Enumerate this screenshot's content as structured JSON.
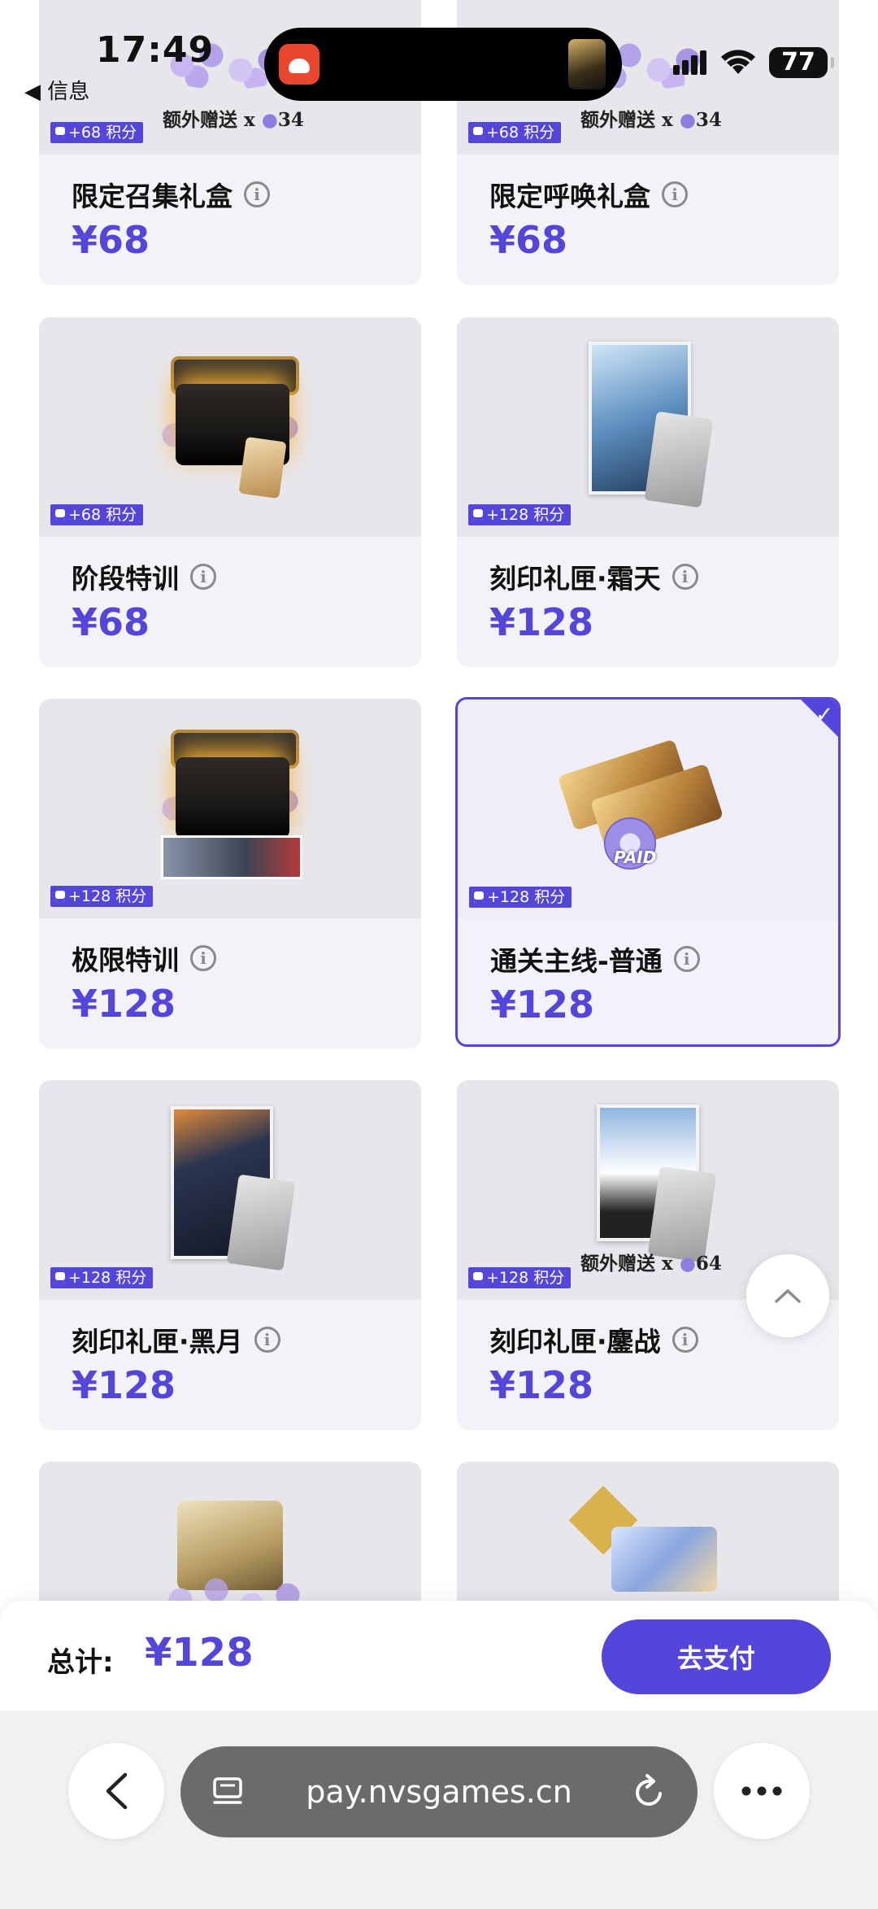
{
  "status_bar": {
    "time": "17:49",
    "back_hint": "◀ 信息",
    "battery": "77"
  },
  "products": [
    {
      "name": "限定召集礼盒",
      "price": "¥68",
      "bonus": "+68 积分",
      "extra_gift": "额外赠送 x",
      "extra_count": "34",
      "selected": false
    },
    {
      "name": "限定呼唤礼盒",
      "price": "¥68",
      "bonus": "+68 积分",
      "extra_gift": "额外赠送 x",
      "extra_count": "34",
      "selected": false
    },
    {
      "name": "阶段特训",
      "price": "¥68",
      "bonus": "+68 积分",
      "selected": false
    },
    {
      "name": "刻印礼匣·霜天",
      "price": "¥128",
      "bonus": "+128 积分",
      "selected": false
    },
    {
      "name": "极限特训",
      "price": "¥128",
      "bonus": "+128 积分",
      "selected": false
    },
    {
      "name": "通关主线-普通",
      "price": "¥128",
      "bonus": "+128 积分",
      "ticket_text": "PAID",
      "selected": true
    },
    {
      "name": "刻印礼匣·黑月",
      "price": "¥128",
      "bonus": "+128 积分",
      "selected": false
    },
    {
      "name": "刻印礼匣·鏖战",
      "price": "¥128",
      "bonus": "+128 积分",
      "extra_gift": "额外赠送 x",
      "extra_count": "64",
      "selected": false
    }
  ],
  "checkout": {
    "total_label": "总计:",
    "total_value": "¥128",
    "pay_label": "去支付"
  },
  "browser": {
    "url": "pay.nvsgames.cn"
  },
  "colors": {
    "accent": "#5546db",
    "card_bg": "#f3f2f7",
    "image_bg": "#e7e6eb",
    "selected_bg": "#f2f1fc"
  },
  "icons": [
    "info-icon",
    "check-icon",
    "coin-icon",
    "chevron-up-icon",
    "chevron-left-icon",
    "reader-icon",
    "reload-icon",
    "more-icon",
    "signal-icon",
    "wifi-icon",
    "battery-icon"
  ]
}
